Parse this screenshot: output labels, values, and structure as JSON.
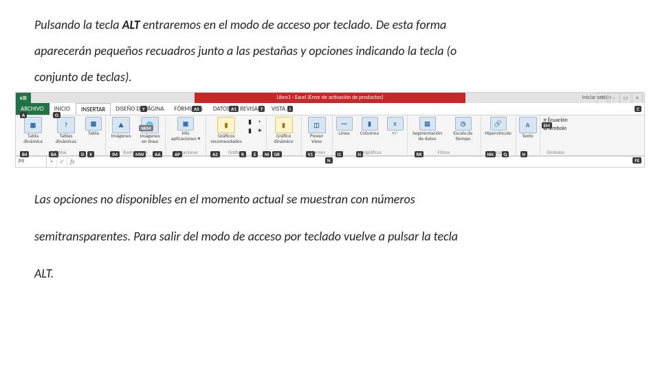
{
  "intro": {
    "line1a": "Pulsando la tecla ",
    "line1b": "ALT",
    "line1c": " entraremos en el modo de acceso por teclado. De esta forma",
    "line2": "aparecerán pequeños recuadros junto a las pestañas y opciones indicando la tecla (o",
    "line3": "conjunto de teclas)."
  },
  "excel": {
    "app_badge": "x≣",
    "title": "Libro1 - Excel (Error de activación de productos)",
    "sign_in": "Iniciar sesión",
    "winbtns": {
      "help": "?",
      "minimize": "–",
      "restore": "▭",
      "close": "×"
    },
    "tabs": {
      "archivo": "ARCHIVO",
      "inicio": "INICIO",
      "insertar": "INSERTAR",
      "diseno": "DISEÑO DE PÁGINA",
      "formulas": "FÓRMULAS",
      "datos": "DATOS",
      "revisar": "REVISAR",
      "vista": "VISTA",
      "prog": "⚙"
    },
    "groups": {
      "tablas": {
        "name": "Tablas",
        "items": {
          "pivot": "Tabla\ndinámica",
          "recpivot": "Tablas\ndinámicas",
          "tabla": "Tabla"
        }
      },
      "ilustr": {
        "name": "Ilustraciones",
        "items": {
          "img": "Imágenes",
          "imgweb": "Imágenes\nen línea"
        }
      },
      "apps": {
        "name": "Aplicaciones",
        "item": "Mis aplicaciones ▾"
      },
      "charts": {
        "name": "Gráficos",
        "item": "Gráficos\nrecomendados"
      },
      "pivotchart": {
        "name": "",
        "item": "Gráfico\ndinámico"
      },
      "reports": {
        "name": "Informes",
        "item": "Power\nView"
      },
      "spark": {
        "name": "Minigráficos",
        "items": {
          "line": "Línea",
          "col": "Columna",
          "wl": "+/-"
        }
      },
      "filters": {
        "name": "Filtros",
        "items": {
          "seg": "Segmentación\nde datos",
          "time": "Escala de\ntiempo"
        }
      },
      "links": {
        "name": "Vínculos",
        "item": "Hipervínculo"
      },
      "text": {
        "name": "Texto",
        "item": "Texto"
      },
      "symbols": {
        "name": "Símbolos",
        "items": {
          "eq": "Ecuación",
          "sym": "Símbolo"
        }
      }
    },
    "fbar": {
      "name": "P9",
      "fx": "fx"
    },
    "keytips": {
      "tabs": {
        "archivo": "A",
        "inicio": "O",
        "diseno": "Y",
        "formulas": "AS",
        "datos": "A1",
        "revisar": "T",
        "vista": "I"
      },
      "ribbon": [
        "B4",
        "BA",
        "D",
        "X",
        "IM",
        "MW",
        "AA",
        "AP",
        "A2",
        "R",
        "E",
        "NI",
        "GR",
        "V1",
        "I1",
        "H",
        "RR",
        "NN",
        "Q",
        "H",
        "EM",
        "C"
      ],
      "other": {
        "n": "N",
        "fe": "FE"
      }
    }
  },
  "outro": {
    "line1": "Las opciones no disponibles en el momento actual se muestran con números",
    "line2": "semitransparentes. Para salir del modo de acceso por teclado vuelve a pulsar la tecla",
    "line3": "ALT."
  }
}
